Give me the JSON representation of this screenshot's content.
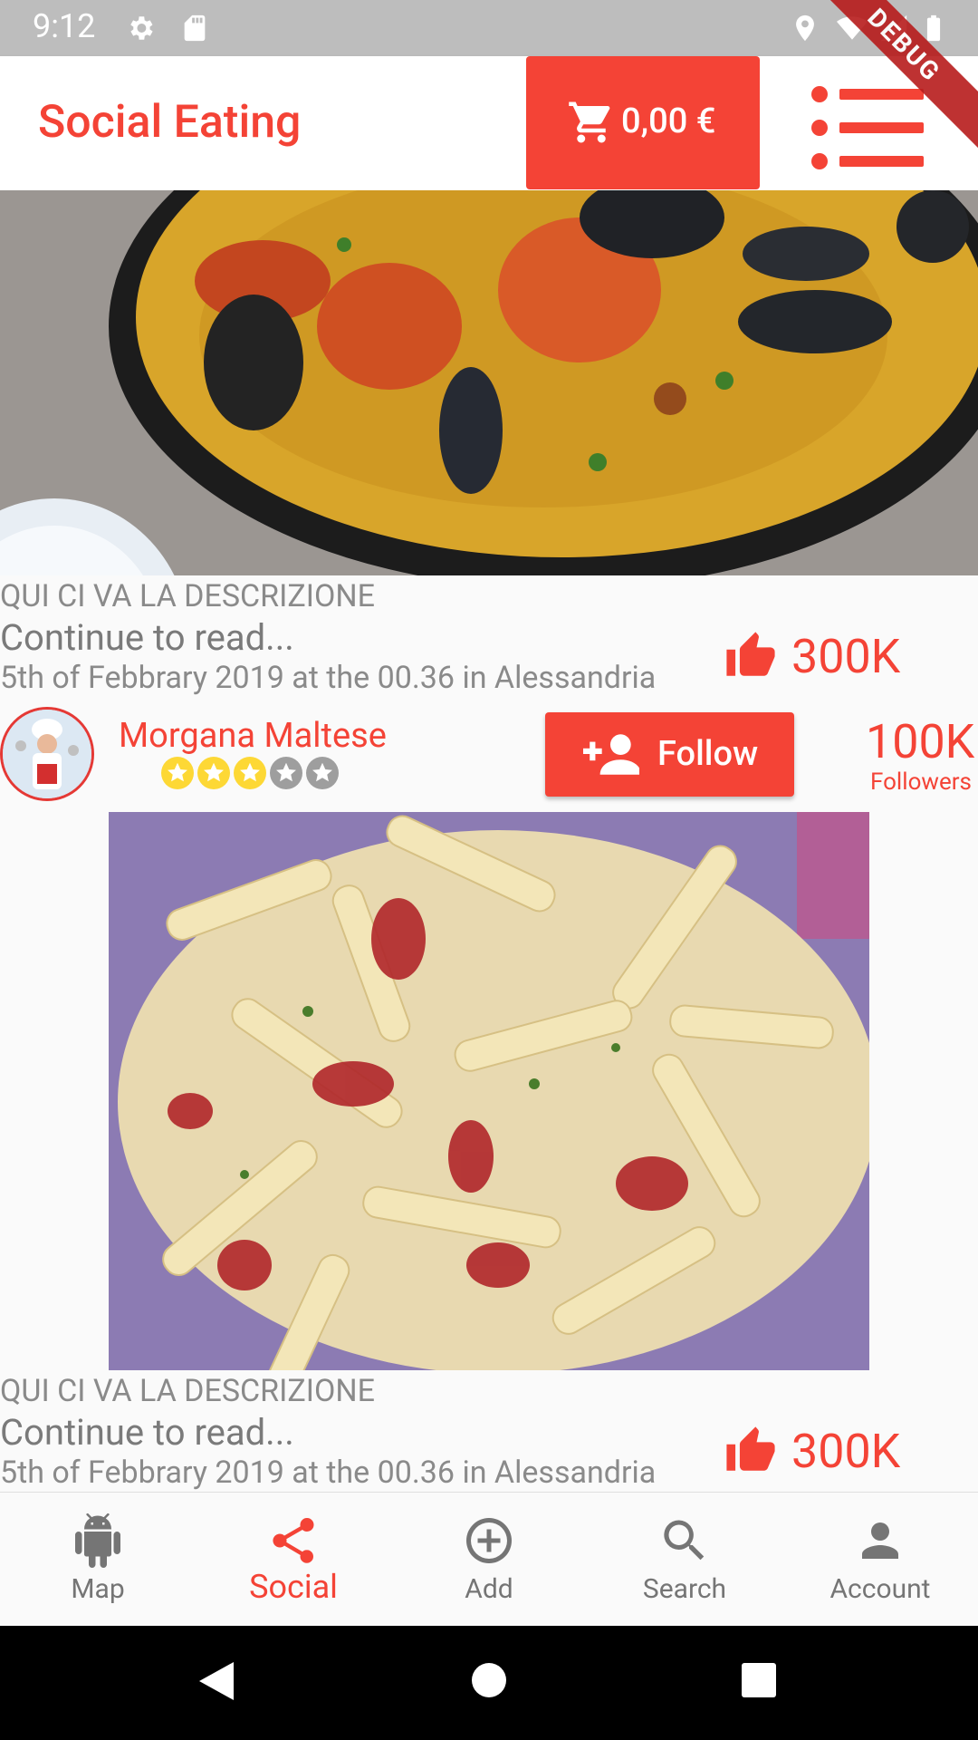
{
  "status_bar": {
    "time": "9:12",
    "debug_label": "DEBUG"
  },
  "app_bar": {
    "title": "Social Eating",
    "cart_amount": "0,00 €"
  },
  "posts": [
    {
      "description": "QUI CI VA LA DESCRIZIONE",
      "continue_label": "Continue to read...",
      "date_location": "5th of Febbrary 2019 at the 00.36 in Alessandria",
      "likes": "300K"
    },
    {
      "description": "QUI CI VA LA DESCRIZIONE",
      "continue_label": "Continue to read...",
      "date_location": "5th of Febbrary 2019 at the 00.36 in Alessandria",
      "likes": "300K"
    }
  ],
  "user": {
    "name": "Morgana Maltese",
    "rating": 3,
    "rating_max": 5,
    "follow_label": "Follow",
    "followers_count": "100K",
    "followers_label": "Followers"
  },
  "bottom_nav": [
    {
      "label": "Map",
      "icon": "android-icon",
      "active": false
    },
    {
      "label": "Social",
      "icon": "share-icon",
      "active": true
    },
    {
      "label": "Add",
      "icon": "add-circle-icon",
      "active": false
    },
    {
      "label": "Search",
      "icon": "search-icon",
      "active": false
    },
    {
      "label": "Account",
      "icon": "account-icon",
      "active": false
    }
  ],
  "colors": {
    "accent": "#f44336",
    "star_filled": "#fdd835",
    "star_empty": "#9e9e9e"
  }
}
